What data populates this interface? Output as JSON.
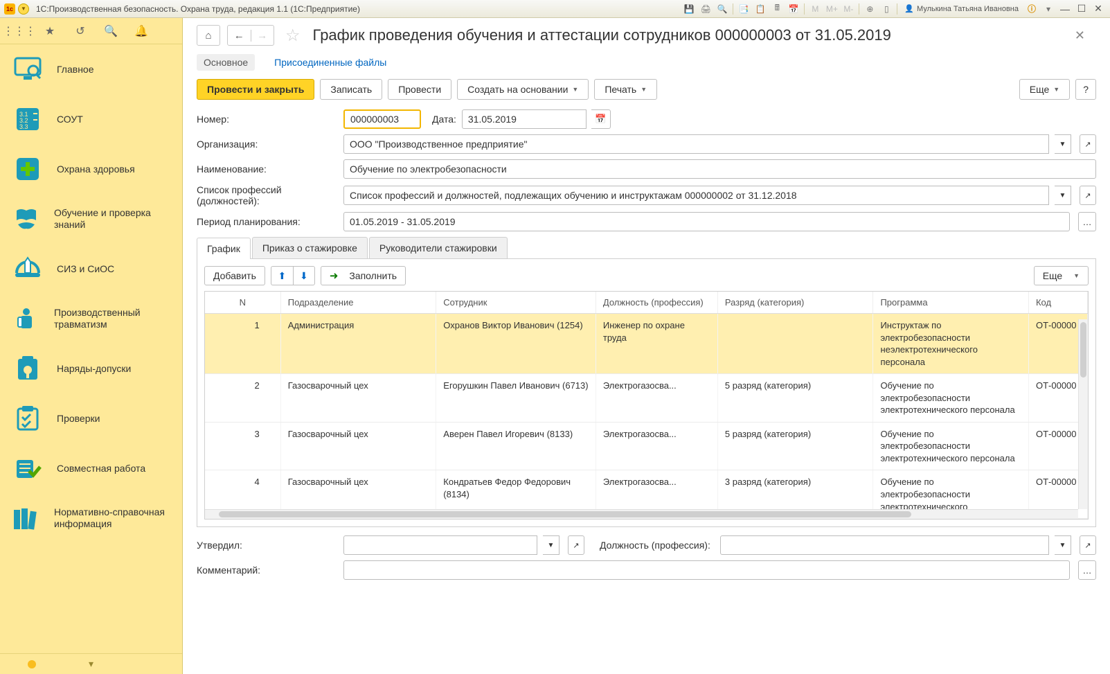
{
  "titlebar": {
    "app_title": "1С:Производственная безопасность. Охрана труда, редакция 1.1  (1С:Предприятие)",
    "user": "Мулькина Татьяна Ивановна",
    "m_buttons": [
      "M",
      "M+",
      "M-"
    ]
  },
  "sidebar": {
    "items": [
      {
        "label": "Главное"
      },
      {
        "label": "СОУТ"
      },
      {
        "label": "Охрана здоровья"
      },
      {
        "label": "Обучение и проверка знаний"
      },
      {
        "label": "СИЗ и СиОС"
      },
      {
        "label": "Производственный травматизм"
      },
      {
        "label": "Наряды-допуски"
      },
      {
        "label": "Проверки"
      },
      {
        "label": "Совместная работа"
      },
      {
        "label": "Нормативно-справочная информация"
      }
    ]
  },
  "header": {
    "title": "График проведения обучения и аттестации сотрудников 000000003 от 31.05.2019"
  },
  "section_tabs": {
    "main": "Основное",
    "files": "Присоединенные файлы"
  },
  "toolbar": {
    "post_close": "Провести и закрыть",
    "save": "Записать",
    "post": "Провести",
    "create_based": "Создать на основании",
    "print": "Печать",
    "more": "Еще"
  },
  "form": {
    "number_label": "Номер:",
    "number_value": "000000003",
    "date_label": "Дата:",
    "date_value": "31.05.2019",
    "org_label": "Организация:",
    "org_value": "ООО \"Производственное предприятие\"",
    "name_label": "Наименование:",
    "name_value": "Обучение по электробезопасности",
    "list_label": "Список профессий (должностей):",
    "list_value": "Список профессий и должностей, подлежащих обучению и инструктажам 000000002 от 31.12.2018",
    "period_label": "Период планирования:",
    "period_value": "01.05.2019 - 31.05.2019"
  },
  "inner_tabs": {
    "schedule": "График",
    "intern_order": "Приказ о стажировке",
    "supervisors": "Руководители стажировки"
  },
  "panel_toolbar": {
    "add": "Добавить",
    "fill": "Заполнить",
    "more": "Еще"
  },
  "table": {
    "headers": {
      "n": "N",
      "department": "Подразделение",
      "employee": "Сотрудник",
      "position": "Должность (профессия)",
      "category": "Разряд (категория)",
      "program": "Программа",
      "code": "Код"
    },
    "rows": [
      {
        "n": "1",
        "dep": "Администрация",
        "emp": "Охранов Виктор Иванович (1254)",
        "pos": "Инженер по охране труда",
        "cat": "",
        "prog": "Инструктаж по электробезопасности неэлектротехнического персонала",
        "code": "ОТ-00000"
      },
      {
        "n": "2",
        "dep": "Газосварочный цех",
        "emp": "Егорушкин Павел Иванович (6713)",
        "pos": "Электрогазосва...",
        "cat": "5 разряд (категория)",
        "prog": "Обучение по электробезопасности электротехнического персонала",
        "code": "ОТ-00000"
      },
      {
        "n": "3",
        "dep": "Газосварочный цех",
        "emp": "Аверен Павел Игоревич (8133)",
        "pos": "Электрогазосва...",
        "cat": "5 разряд (категория)",
        "prog": "Обучение по электробезопасности электротехнического персонала",
        "code": "ОТ-00000"
      },
      {
        "n": "4",
        "dep": "Газосварочный цех",
        "emp": "Кондратьев Федор Федорович (8134)",
        "pos": "Электрогазосва...",
        "cat": "3 разряд (категория)",
        "prog": "Обучение по электробезопасности электротехнического",
        "code": "ОТ-00000"
      }
    ]
  },
  "footer": {
    "approved_label": "Утвердил:",
    "position_label": "Должность (профессия):",
    "comment_label": "Комментарий:"
  },
  "help_q": "?"
}
